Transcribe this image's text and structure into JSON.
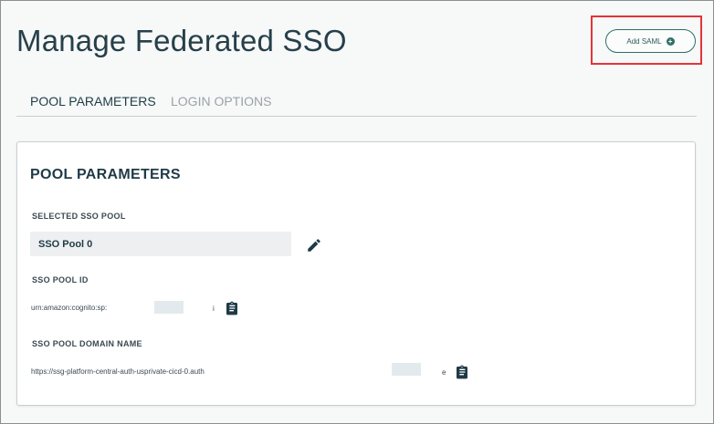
{
  "page": {
    "title": "Manage Federated SSO"
  },
  "header": {
    "add_saml_label": "Add SAML"
  },
  "tabs": [
    {
      "label": "POOL PARAMETERS",
      "active": true
    },
    {
      "label": "LOGIN OPTIONS",
      "active": false
    }
  ],
  "card": {
    "title": "POOL PARAMETERS",
    "selected_pool": {
      "label": "SELECTED SSO POOL",
      "value": "SSO Pool 0"
    },
    "pool_id": {
      "label": "SSO POOL ID",
      "value": "urn:amazon:cognito:sp:",
      "suffix": "i"
    },
    "domain": {
      "label": "SSO POOL DOMAIN NAME",
      "value": "https://ssg-platform-central-auth-usprivate-cicd-0.auth",
      "suffix": "e"
    }
  },
  "colors": {
    "accent": "#2f6f66",
    "highlight": "#e2343a",
    "title": "#26404a"
  },
  "icons": [
    "plus-circle-icon",
    "edit-pencil-icon",
    "clipboard-copy-icon"
  ]
}
